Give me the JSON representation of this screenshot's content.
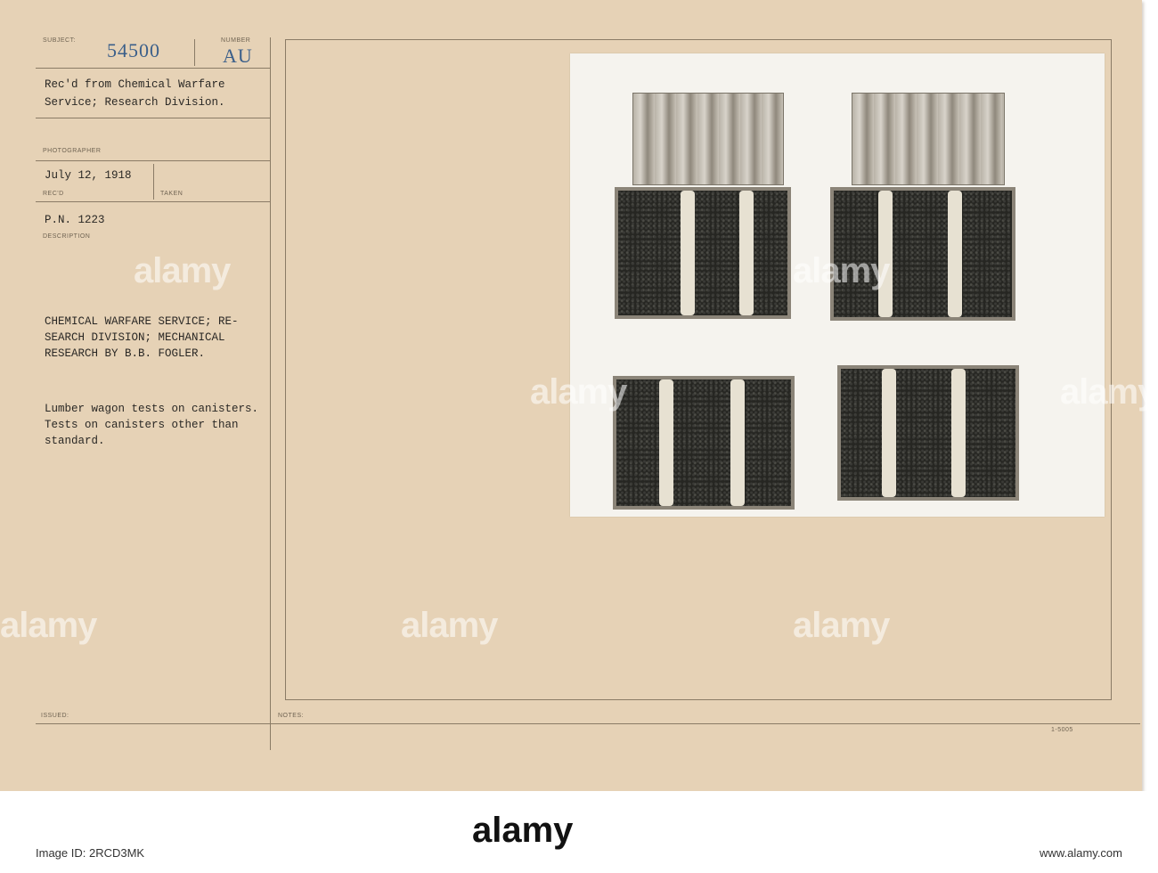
{
  "card": {
    "labels": {
      "subject": "SUBJECT:",
      "number": "NUMBER",
      "photographer": "PHOTOGRAPHER",
      "recd": "REC'D",
      "taken": "TAKEN",
      "description": "DESCRIPTION",
      "issued": "ISSUED:",
      "notes": "NOTES:"
    },
    "subject_number": "54500",
    "series_code": "AU",
    "source_line1": "Rec'd from Chemical Warfare",
    "source_line2": "Service; Research Division.",
    "date": "July 12, 1918",
    "pn": "P.N. 1223",
    "desc_line1": "CHEMICAL WARFARE SERVICE; RE-",
    "desc_line2": "SEARCH DIVISION; MECHANICAL",
    "desc_line3": "RESEARCH BY B.B. FOGLER.",
    "caption_line1": "Lumber wagon tests on canisters.",
    "caption_line2": "Tests on canisters other than",
    "caption_line3": "standard.",
    "form_code": "1-5005"
  },
  "watermark": {
    "text": "alamy",
    "image_id": "Image ID: 2RCD3MK",
    "site": "www.alamy.com"
  }
}
